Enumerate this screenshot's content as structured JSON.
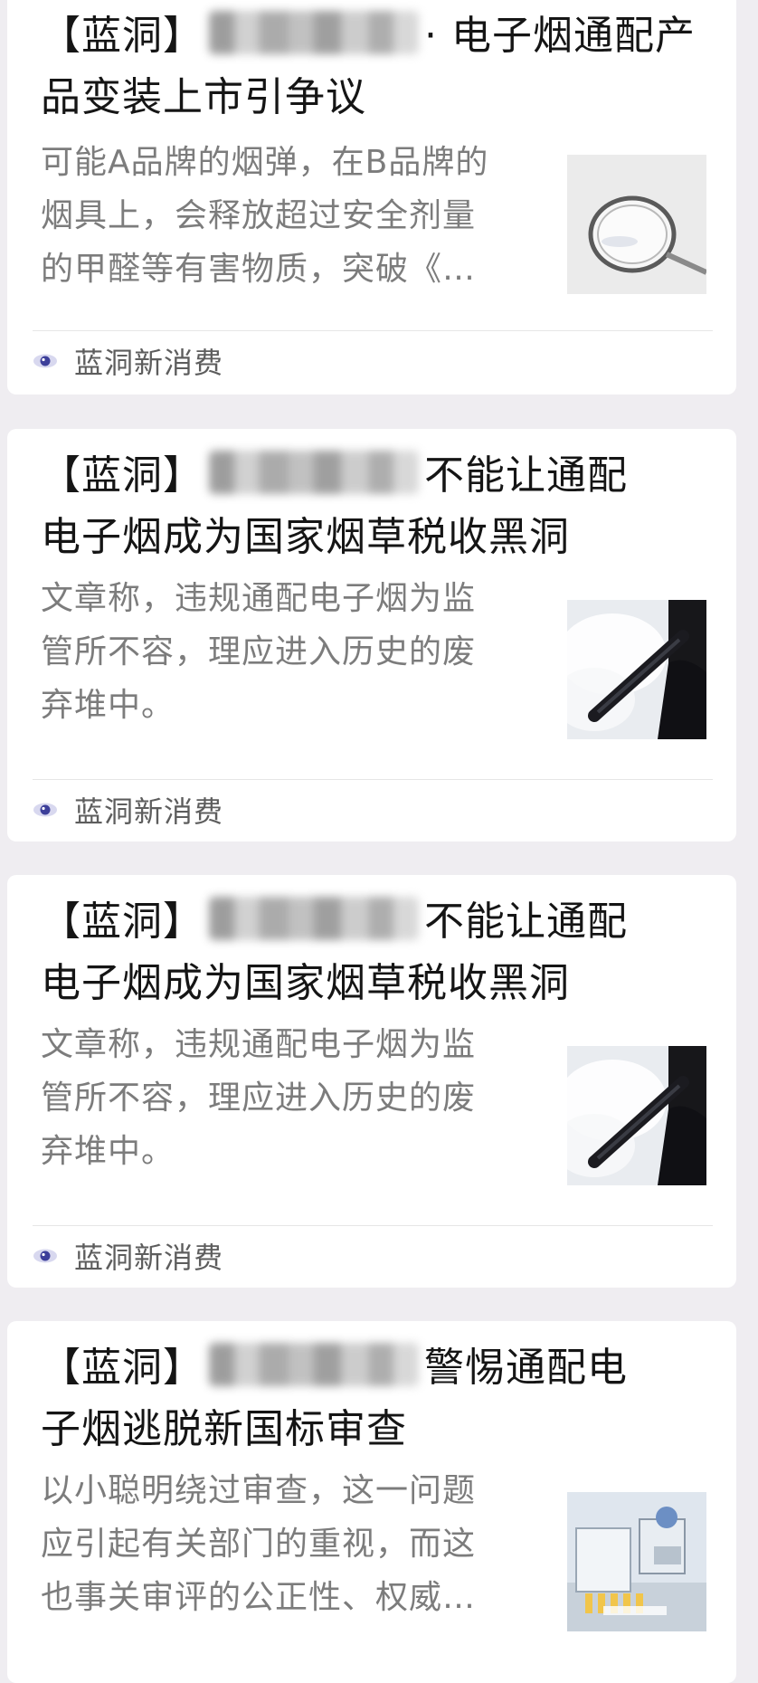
{
  "articles": [
    {
      "title_line1_prefix": "【蓝洞】",
      "title_line1_suffix": "· 电子烟通配产",
      "title_line2": "品变装上市引争议",
      "summary_line1": "可能A品牌的烟弹，在B品牌的",
      "summary_line2": "烟具上，会释放超过安全剂量",
      "summary_line3": "的甲醛等有害物质，突破《…",
      "thumbnail_icon": "magnifier",
      "source": "蓝洞新消费",
      "source_icon": "eye-icon"
    },
    {
      "title_line1_prefix": "【蓝洞】",
      "title_line1_suffix": "不能让通配",
      "title_line2": "电子烟成为国家烟草税收黑洞",
      "summary_line1": "文章称，违规通配电子烟为监",
      "summary_line2": "管所不容，理应进入历史的废",
      "summary_line3": "弃堆中。",
      "thumbnail_icon": "vape",
      "source": "蓝洞新消费",
      "source_icon": "eye-icon"
    },
    {
      "title_line1_prefix": "【蓝洞】",
      "title_line1_suffix": "不能让通配",
      "title_line2": "电子烟成为国家烟草税收黑洞",
      "summary_line1": "文章称，违规通配电子烟为监",
      "summary_line2": "管所不容，理应进入历史的废",
      "summary_line3": "弃堆中。",
      "thumbnail_icon": "vape",
      "source": "蓝洞新消费",
      "source_icon": "eye-icon"
    },
    {
      "title_line1_prefix": "【蓝洞】",
      "title_line1_suffix": "警惕通配电",
      "title_line2": "子烟逃脱新国标审查",
      "summary_line1": "以小聪明绕过审查，这一问题",
      "summary_line2": "应引起有关部门的重视，而这",
      "summary_line3": "也事关审评的公正性、权威…",
      "thumbnail_icon": "lab-equipment"
    }
  ],
  "colors": {
    "background": "#efedf1",
    "card": "#ffffff",
    "title": "#151515",
    "summary": "#7c7c7c",
    "source": "#5d5d5d",
    "eye_icon": "#3d3f9a"
  }
}
